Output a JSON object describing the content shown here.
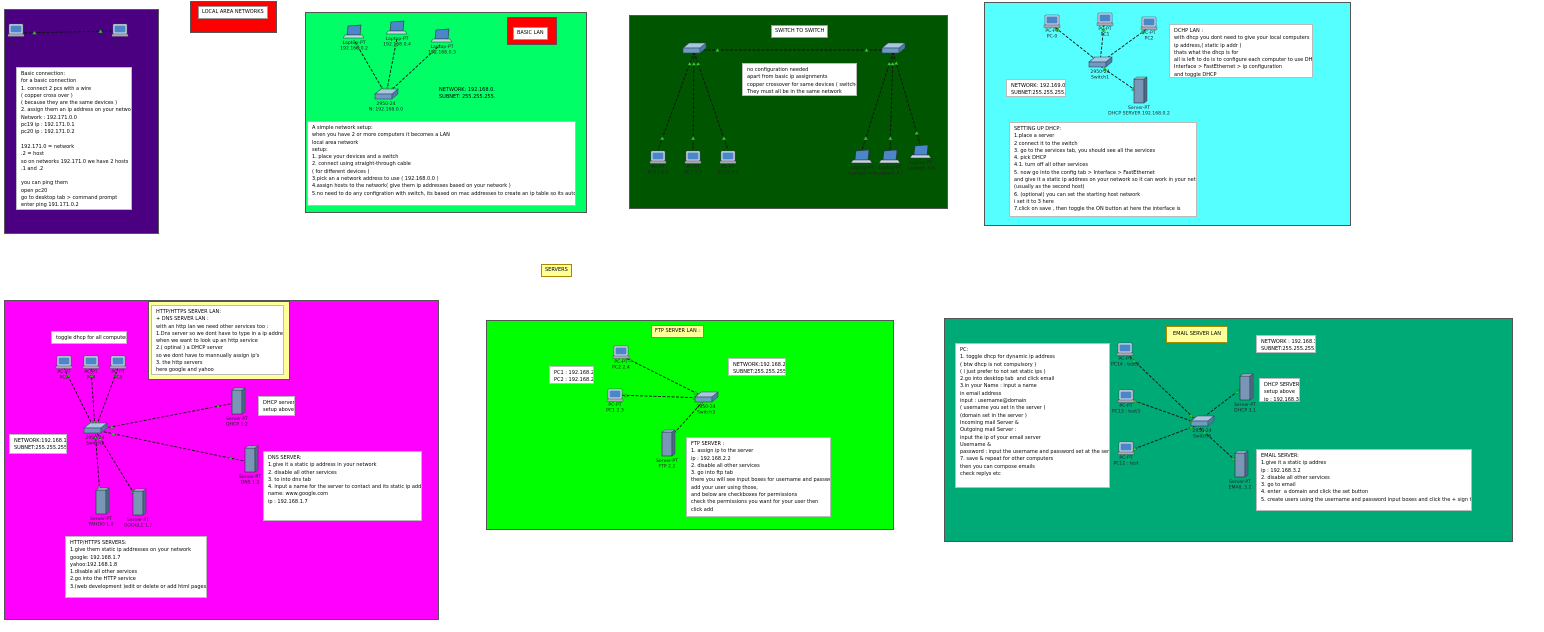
{
  "colors": {
    "purple": "#4b0082",
    "red": "#ff0000",
    "green": "#00ff66",
    "dark_green": "#005500",
    "cyan": "#55ffff",
    "magenta": "#ff00ff",
    "lime": "#00ff00",
    "teal": "#00aa77",
    "yellow_note": "#ffff99"
  },
  "titles": {
    "local_area_networks": "LOCAL AREA NETWORKS",
    "basic_lan": "BASIC LAN",
    "switch_to_switch": "SWITCH TO SWITCH",
    "servers": "SERVERS",
    "ftp_server_lan": "FTP SERVER LAN :",
    "email_server_lan": "EMAIL SERVER LAN"
  },
  "basic_connection": {
    "devices": [
      "PC-PT",
      "PC-PT"
    ],
    "note": "Basic connection:\nfor a basic connection\n1. connect 2 pcs with a wire\n( copper cross over )\n( because they are the same devices )\n2. assign them an ip address on your network\nNetwork : 192.171.0.0\npc19 ip : 192.171.0.1\npc20 ip : 192.171.0.2\n\n192.171.0 = network\n.2 = host\nso on networks 192.171.0 we have 2 hosts\n.1 and .2\n\nyou can ping them\nopen pc20\ngo to desktop tab > command prompt\nenter ping 191.171.0.2"
  },
  "basic_lan": {
    "laptops": [
      "Laptop-PT\n192.168.0.2",
      "Laptop-PT\n192.168.0.4",
      "Laptop-PT\n192.168.0.3"
    ],
    "switch": "2950-24\nN: 192.168.0.0",
    "network_info": "NETWORK: 192.168.0.0\nSUBNET: 255.255.255.0",
    "note": "A simple network setup:\nwhen you have 2 or more computers it becomes a LAN\nlocal area network\nsetup:\n1. place your devices and a switch\n2. connect using straight-through cable\n( for different devices )\n3.pick an a network address to use ( 192.168.0.0 )\n4.assign hosts to the network( give them ip addresses based on your network )\n5.no need to do any configration with switch, its based on mac addresses to create an ip table so its automatic"
  },
  "switch_to_switch": {
    "note": "no configuration needed\napart from basic ip assignments\ncopper crossover for same devices ( switches )\nThey must all be in the same network",
    "left_pcs": [
      "PC-PT\nPC11.4.2",
      "PC-PT\nPC7.1.3",
      "PC-PT\nPC11.3.4"
    ],
    "right_laptops": [
      "Laptop-PT\nLaptop5.4.6",
      "Laptop-PT\nLaptop5.4.7",
      "Laptop-PT\nLaptop5.4.8"
    ]
  },
  "dhcp_lan": {
    "pcs": [
      "PC-PT\nPC-0",
      "PC-PT\nPC1",
      "PC-PT\nPC2"
    ],
    "switch": "2950-24\nSwitch1",
    "server": "Server-PT\nDHCP SERVER 192.168.0.2",
    "description": "DCHP LAN :\nwith dhcp you dont need to give your local computers\nip address,( static ip addr )\nthats what the dhcp is for\nall is left to do is to configure each computer to use DHCP\nInterface > FastEthernet > ip configuration\nand toggle DHCP",
    "network_info": "NETWORK: 192.169.0.0\nSUBNET:255.255.255.0",
    "setup": "SETTING UP DHCP:\n1.place a server\n2 connect it to the switch\n3. go to the services tab, you should see all the services\n4. pick DHCP\n4.1. turn off all other services\n5. now go into the config tab > Interface > FastEthernet\nand give it a static ip address on your network so it can work in your network\n(usually as the second host)\n6. (optional) you can set the starting host network\ni set it to 3 here\n7.click on save , then toggle the ON button at here the interface is"
  },
  "servers_lan": {
    "info_box": "HTTP/HTTPS SERVER LAN:\n+ DNS SERVER LAN :\nwith an http lan we need other services too :\n1.Dns server so we dont have to type in a ip address\nwhen we want to look up an http service\n2.( optinal ) a DHCP server\nso we dont have to mannually assign ip's\n3. the http servers\nhere google and yahoo",
    "toggle_note": "toggle dhcp for all computers",
    "pcs": [
      "PC-PT\nPC3",
      "PC-PT\nPC4",
      "PC-PT\nPC5"
    ],
    "switch": "2950-24\nSwitch2",
    "network_info": "NETWORK:192.168.1.0\nSUBNET:255.255.255.0",
    "dhcp_server": "Server-PT\nDHCP 1.2",
    "dhcp_note": "DHCP server:\nsetup above",
    "dns_server": "Server-PT\nDNS 1.3",
    "dns_note": "DNS SERVER:\n1.give it a static ip address in your network\n2. disable all other services\n3. to into dns tab\n4. input a name for the server to contact and its static ip address\nname: www.google.com\nip : 192.168.1.7",
    "yahoo_server": "Server-PT\nYAHOO 1.8",
    "google_server": "Server-PT\nGOOGLE 1.7",
    "http_note": "HTTP/HTTPS SERVERS:\n1.give them static ip addresses on your network\ngoogle: 192.168.1.7\nyahoo:192.168.1.8\n1.disable all other services\n2.go into the HTTP service\n3.(web development )edit or delete or add html pages etc"
  },
  "ftp_lan": {
    "pc_ips": "PC1 : 192.168.2.3\nPC2 : 192.168.2.4",
    "pcs": [
      "PC-PT\nPC2 2.4",
      "PC-PT\nPC1 2.3"
    ],
    "switch": "2950-24\nSwitch3",
    "server": "Server-PT\nFTP 2.2",
    "network_info": "NETWORK:192.168.2.0\nSUBNET:255.255.255.0",
    "note": "FTP SERVER :\n1. assign ip to the server\nip : 192.168.2.2\n2. disable all other services\n3. go into ftp tab\nthere you will see input boxes for username and password\nadd your user using those,\nand below are checkboxes for permissions\ncheck the permissions you want for your user then\nclick add"
  },
  "email_lan": {
    "pc_note": "PC:\n1. toggle dhcp for dynamic ip address\n( btw dhcp is not compulsory )\n( i just prefer to not set static ips )\n2.go into desktop tab  and click email\n3.in your Name : input a name\nin email address\ninput : username@domain\n( username you set in the server )\n(domain set in the server )\nIncoming mail Server &\nOutgoing mail Server :\ninput the ip of your email server\nUsername &\npassword : input the username and password set at the server\n7. save & repeat for other computers\nthen you can compose emails\ncheck replys etc",
    "pcs": [
      "PC-PT\nPC14 : test3",
      "PC-PT\nPC13 : test3",
      "PC-PT\nPC12 : test"
    ],
    "switch": "2950-24\nSwitch4",
    "network_info": "NETWORK : 192.168.3.0\nSUBNET:255.255.255.0",
    "dhcp_server": "Server-PT\nDHCP 3.1",
    "dhcp_note": "DHCP SERVER;\nsetup above\nip : 192.168.3.1",
    "email_server": "Server-PT\nEMAIL 3.2",
    "email_note": "EMAIL SERVER:\n1.give it a static ip addres\nip : 192.168.3.2\n2. disable all other services\n3. go to email\n4. enter  a domain and click the set button\n5. create users using the username and password input boxes and click the + sign to add"
  }
}
